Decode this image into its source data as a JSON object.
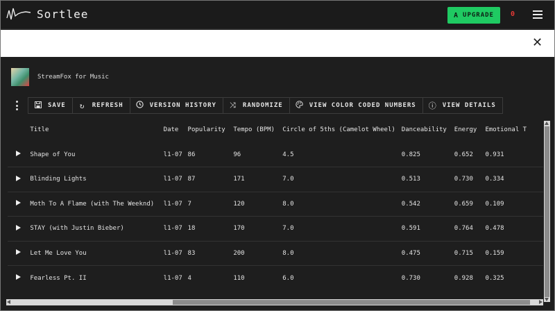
{
  "app": {
    "name": "Sortlee",
    "upgrade_label": "UPGRADE",
    "notification_count": "0"
  },
  "icons": {
    "logo": "waveform-logo-icon",
    "upgrade": "upgrade-a-icon",
    "menu": "hamburger-menu-icon",
    "close": "close-icon",
    "more": "more-vert-icon",
    "play": "play-icon"
  },
  "colors": {
    "accent": "#1fca62",
    "notification": "#e53935",
    "background": "#1e1e1e"
  },
  "close_symbol": "✕",
  "playlist": {
    "name": "StreamFox for Music"
  },
  "toolbar": {
    "save": "SAVE",
    "refresh": "REFRESH",
    "version_history": "VERSION HISTORY",
    "randomize": "RANDOMIZE",
    "view_color_coded": "VIEW COLOR CODED NUMBERS",
    "view_details": "VIEW DETAILS"
  },
  "toolbar_icons": {
    "save": "💾",
    "refresh": "↻",
    "version_history": "🕓",
    "randomize": "⤨",
    "view_color_coded": "🎨",
    "view_details": "ⓘ"
  },
  "table": {
    "columns": [
      "Title",
      "Date",
      "Popularity",
      "Tempo (BPM)",
      "Circle of 5ths (Camelot Wheel)",
      "Danceability",
      "Energy",
      "Emotional T"
    ],
    "rows": [
      {
        "title": "Shape of You",
        "date": "l1-07",
        "popularity": "86",
        "tempo": "96",
        "camelot": "4.5",
        "danceability": "0.825",
        "energy": "0.652",
        "emotional": "0.931"
      },
      {
        "title": "Blinding Lights",
        "date": "l1-07",
        "popularity": "87",
        "tempo": "171",
        "camelot": "7.0",
        "danceability": "0.513",
        "energy": "0.730",
        "emotional": "0.334"
      },
      {
        "title": "Moth To A Flame (with The Weeknd)",
        "date": "l1-07",
        "popularity": "7",
        "tempo": "120",
        "camelot": "8.0",
        "danceability": "0.542",
        "energy": "0.659",
        "emotional": "0.109"
      },
      {
        "title": "STAY (with Justin Bieber)",
        "date": "l1-07",
        "popularity": "18",
        "tempo": "170",
        "camelot": "7.0",
        "danceability": "0.591",
        "energy": "0.764",
        "emotional": "0.478"
      },
      {
        "title": "Let Me Love You",
        "date": "l1-07",
        "popularity": "83",
        "tempo": "200",
        "camelot": "8.0",
        "danceability": "0.475",
        "energy": "0.715",
        "emotional": "0.159"
      },
      {
        "title": "Fearless Pt. II",
        "date": "l1-07",
        "popularity": "4",
        "tempo": "110",
        "camelot": "6.0",
        "danceability": "0.730",
        "energy": "0.928",
        "emotional": "0.325"
      }
    ]
  }
}
